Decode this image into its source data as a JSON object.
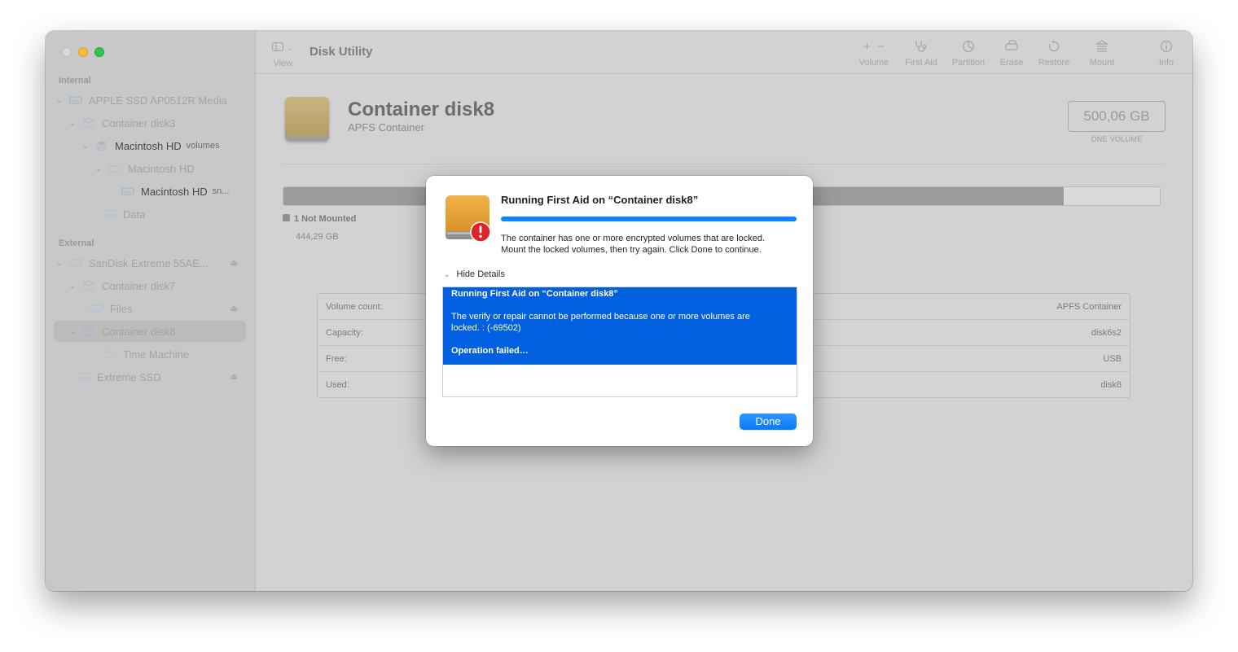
{
  "window": {
    "title": "Disk Utility"
  },
  "sidebar": {
    "internal_label": "Internal",
    "external_label": "External",
    "items": [
      {
        "label": "APPLE SSD AP0512R Media",
        "sub": ""
      },
      {
        "label": "Container disk3",
        "sub": ""
      },
      {
        "label": "Macintosh HD",
        "sub": "volumes"
      },
      {
        "label": "Macintosh HD",
        "sub": ""
      },
      {
        "label": "Macintosh HD",
        "sub": "sn..."
      },
      {
        "label": "Data",
        "sub": ""
      },
      {
        "label": "SanDisk Extreme 55AE...",
        "sub": ""
      },
      {
        "label": "Container disk7",
        "sub": ""
      },
      {
        "label": "Files",
        "sub": ""
      },
      {
        "label": "Container disk8",
        "sub": ""
      },
      {
        "label": "Time Machine",
        "sub": ""
      },
      {
        "label": "Extreme SSD",
        "sub": ""
      }
    ]
  },
  "toolbar": {
    "view": "View",
    "volume": "Volume",
    "first_aid": "First Aid",
    "partition": "Partition",
    "erase": "Erase",
    "restore": "Restore",
    "mount": "Mount",
    "info": "Info"
  },
  "main": {
    "name": "Container disk8",
    "type": "APFS Container",
    "size": "500,06 GB",
    "size_caption": "ONE VOLUME",
    "usage_fraction": 0.89,
    "legend_label": "1 Not Mounted",
    "legend_value": "444,29 GB",
    "info": [
      {
        "label": "Volume count:",
        "value": "APFS Container"
      },
      {
        "label": "Capacity:",
        "value": "disk6s2"
      },
      {
        "label": "Free:",
        "value": "USB"
      },
      {
        "label": "Used:",
        "value": "disk8"
      }
    ]
  },
  "dialog": {
    "title": "Running First Aid on “Container disk8”",
    "progress": 1.0,
    "message_line1": "The container has one or more encrypted volumes that are locked.",
    "message_line2": "Mount the locked volumes, then try again. Click Done to continue.",
    "toggle": "Hide Details",
    "log_title": "Running First Aid on “Container disk8”",
    "log_line1": "The verify or repair cannot be performed because one or more volumes are",
    "log_line2": "locked. : (-69502)",
    "log_result": "Operation failed…",
    "done": "Done"
  },
  "colors": {
    "accent": "#0a84ff",
    "selection": "#0060df",
    "drive_gold": "#e3a43a",
    "alert_red": "#e0222a"
  }
}
